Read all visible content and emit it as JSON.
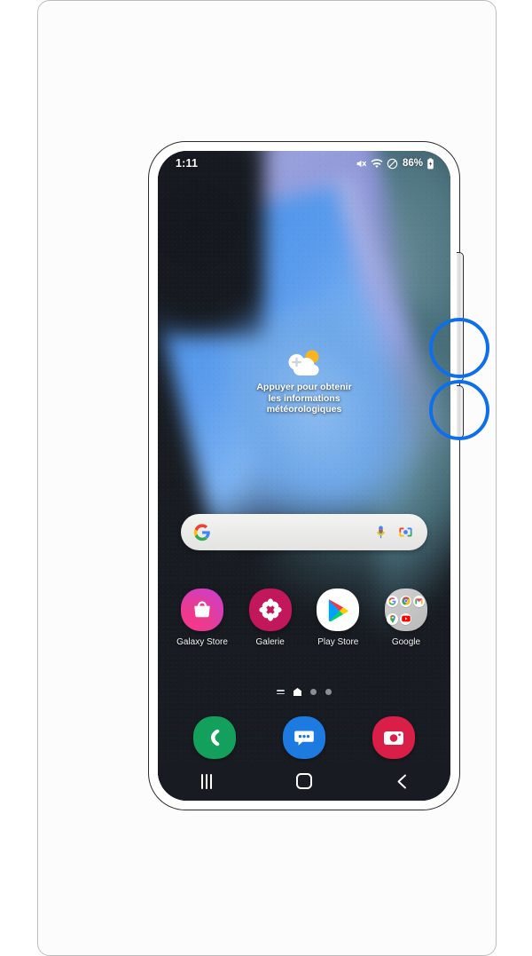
{
  "device": {
    "name": "samsung-galaxy-phone",
    "frame_color": "#ffffff",
    "screen_bg": "#181c22"
  },
  "status_bar": {
    "time": "1:11",
    "battery_percent": "86%",
    "icons": [
      {
        "name": "mute-icon",
        "label": "Sound muted"
      },
      {
        "name": "wifi-icon",
        "label": "Wi-Fi connected"
      },
      {
        "name": "do-not-disturb-icon",
        "label": "Do not disturb"
      },
      {
        "name": "battery-icon",
        "label": "Battery charging"
      }
    ]
  },
  "weather_widget": {
    "icon": "cloud-plus-sun-icon",
    "text": "Appuyer pour obtenir\nles informations\nmétéorologiques"
  },
  "search_bar": {
    "google_icon": "google-g-icon",
    "placeholder": "",
    "value": "",
    "mic_icon": "microphone-icon",
    "lens_icon": "google-lens-icon"
  },
  "app_grid": [
    {
      "name": "galaxy-store",
      "label": "Galaxy Store",
      "icon": "shopping-bag-icon",
      "color": "#ec3b8d"
    },
    {
      "name": "galerie",
      "label": "Galerie",
      "icon": "flower-icon",
      "color": "#c2185b"
    },
    {
      "name": "play-store",
      "label": "Play Store",
      "icon": "play-triangle-icon",
      "color": "#ffffff"
    },
    {
      "name": "google-folder",
      "label": "Google",
      "icon": "folder-icon",
      "color": "#c6c6c6"
    }
  ],
  "google_folder_apps": [
    {
      "name": "google-search-mini-icon",
      "glyph": "G"
    },
    {
      "name": "chrome-mini-icon",
      "glyph": "◉"
    },
    {
      "name": "gmail-mini-icon",
      "glyph": "M"
    },
    {
      "name": "maps-mini-icon",
      "glyph": "◍"
    },
    {
      "name": "youtube-mini-icon",
      "glyph": "▶"
    }
  ],
  "page_indicator": {
    "items": [
      "apps-list-icon",
      "home-page-active",
      "page-dot",
      "page-dot"
    ],
    "active_index": 1
  },
  "dock": [
    {
      "name": "phone",
      "icon": "phone-handset-icon",
      "color": "#12a05c"
    },
    {
      "name": "messages",
      "icon": "speech-bubble-icon",
      "color": "#1d7ae0"
    },
    {
      "name": "camera",
      "icon": "camera-icon",
      "color": "#d91e48"
    }
  ],
  "nav_bar": [
    {
      "name": "recents-button",
      "icon": "recents-lines-icon"
    },
    {
      "name": "home-button",
      "icon": "home-square-icon"
    },
    {
      "name": "back-button",
      "icon": "chevron-left-icon"
    }
  ],
  "annotations": {
    "color": "#0f6fe8",
    "circles": [
      {
        "name": "highlight-volume-button",
        "target": "side-button-upper"
      },
      {
        "name": "highlight-power-button",
        "target": "side-button-lower"
      }
    ]
  },
  "side_buttons": [
    {
      "name": "volume-button",
      "position": "right-upper"
    },
    {
      "name": "power-button",
      "position": "right-lower"
    }
  ]
}
